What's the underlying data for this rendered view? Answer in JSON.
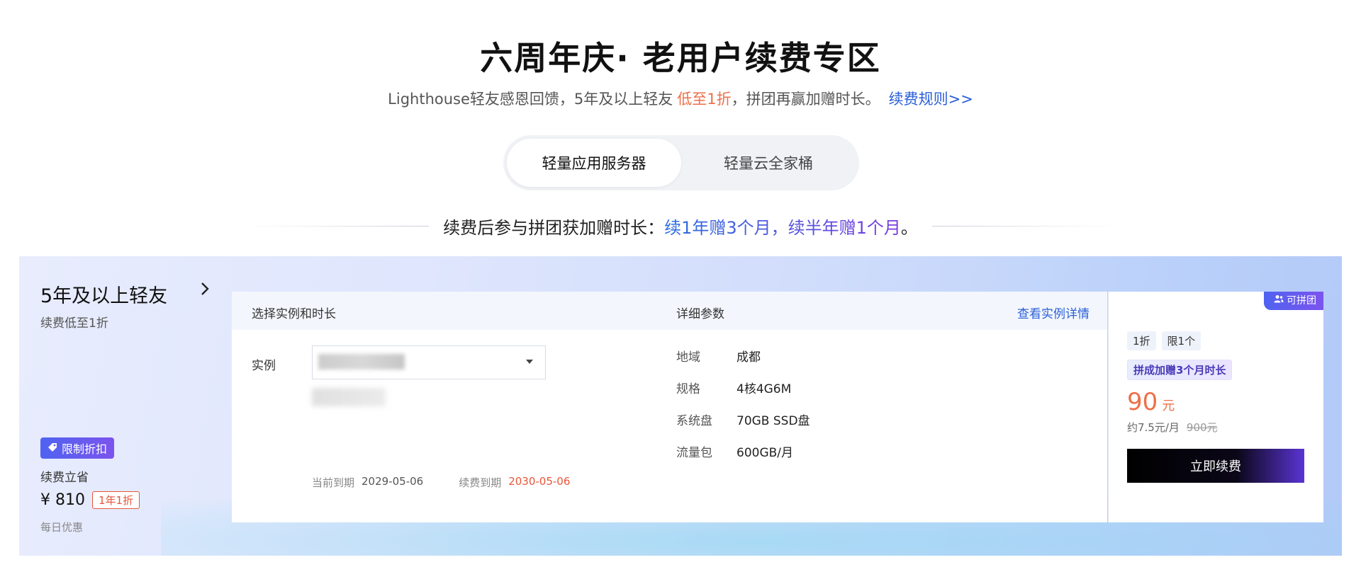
{
  "header": {
    "title": "六周年庆· 老用户续费专区",
    "subtitle_text": "Lighthouse轻友感恩回馈，5年及以上轻友",
    "subtitle_highlight": "低至1折",
    "subtitle_tail": "，拼团再赢加赠时长。",
    "rules_link": "续费规则>>"
  },
  "tabs": [
    {
      "label": "轻量应用服务器",
      "active": true
    },
    {
      "label": "轻量云全家桶",
      "active": false
    }
  ],
  "promo": {
    "lead": "续费后参与拼团获加赠时长：",
    "highlight": "续1年赠3个月，续半年赠1个月",
    "end": "。"
  },
  "sidebar": {
    "category": "5年及以上轻友",
    "category_sub": "续费低至1折",
    "badge": "限制折扣",
    "save_label": "续费立省",
    "amount": "¥ 810",
    "tag": "1年1折",
    "daily": "每日优惠"
  },
  "card": {
    "header_left": "选择实例和时长",
    "header_mid": "详细参数",
    "header_link": "查看实例详情",
    "instance_label": "实例",
    "expire_current_label": "当前到期",
    "expire_current_value": "2029-05-06",
    "expire_renew_label": "续费到期",
    "expire_renew_value": "2030-05-06",
    "params": [
      {
        "key": "地域",
        "value": "成都"
      },
      {
        "key": "规格",
        "value": "4核4G6M"
      },
      {
        "key": "系统盘",
        "value": "70GB SSD盘"
      },
      {
        "key": "流量包",
        "value": "600GB/月"
      }
    ]
  },
  "purchase": {
    "corner_tag": "可拼团",
    "chip_discount": "1折",
    "chip_limit": "限1个",
    "gift": "拼成加赠3个月时长",
    "price": "90",
    "price_unit": "元",
    "per_month": "约7.5元/月",
    "original_price": "900元",
    "button": "立即续费"
  },
  "colors": {
    "accent_blue": "#2a5fd8",
    "accent_orange": "#ee6f48",
    "accent_purple": "#6a4fe6"
  }
}
